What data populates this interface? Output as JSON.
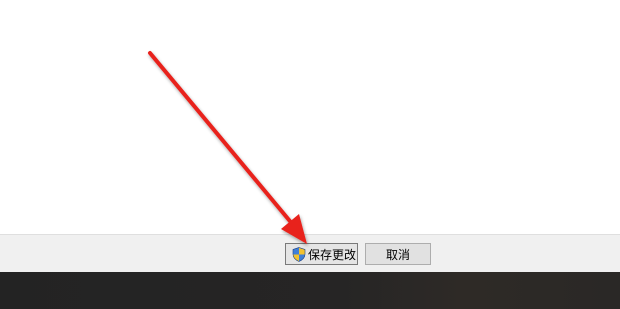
{
  "dialog": {
    "buttons": {
      "save_label": "保存更改",
      "cancel_label": "取消"
    }
  },
  "icons": {
    "save_button_icon": "uac-shield-icon"
  },
  "annotation": {
    "color": "#e8201b"
  }
}
